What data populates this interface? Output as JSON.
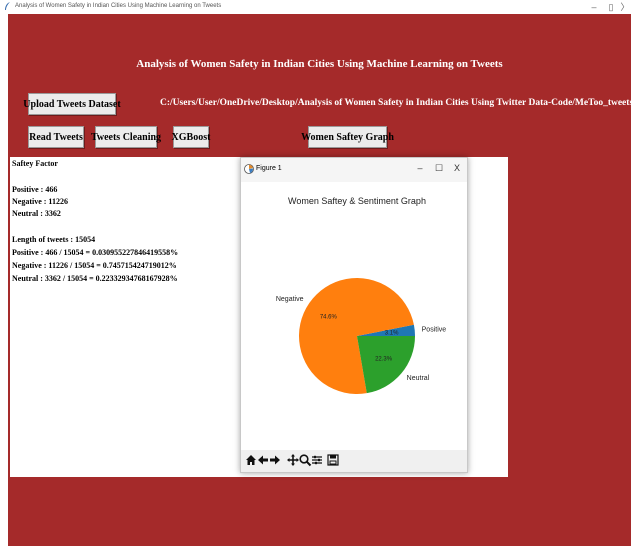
{
  "window": {
    "title": "Analysis of Women Safety in Indian Cities Using Machine Learning on Tweets",
    "minimize": "–",
    "maximize": "▯",
    "close": "〉"
  },
  "app": {
    "heading": "Analysis of Women Safety in Indian Cities Using Machine Learning on Tweets",
    "buttons": {
      "upload": "Upload Tweets Dataset",
      "read": "Read Tweets",
      "clean": "Tweets Cleaning",
      "xgboost": "XGBoost",
      "graph": "Women Saftey Graph"
    },
    "file_path": "C:/Users/User/OneDrive/Desktop/Analysis of Women Safety in Indian Cities Using Twitter Data-Code/MeToo_tweets.csv",
    "output_lines": [
      "Saftey Factor",
      "Positive : 466",
      "Negative : 11226",
      "Neutral  : 3362",
      "Length of tweets  : 15054",
      "Positive : 466 / 15054 = 0.030955227846419558%",
      "Negative : 11226 / 15054 = 0.745715424719012%",
      "Neutral  : 3362 / 15054 = 0.22332934768167928%"
    ]
  },
  "figure": {
    "window_title": "Figure 1",
    "minimize": "–",
    "maximize": "☐",
    "close": "X"
  },
  "chart_data": {
    "type": "pie",
    "title": "Women Saftey & Sentiment Graph",
    "labels": [
      "Positive",
      "Negative",
      "Neutral"
    ],
    "values": [
      3.1,
      74.6,
      22.3
    ],
    "value_labels": [
      "3.1%",
      "74.6%",
      "22.3%"
    ],
    "colors": [
      "#1f77b4",
      "#ff7f0e",
      "#2ca02c"
    ],
    "start_angle_deg": 0,
    "direction": "counterclockwise"
  },
  "colors": {
    "app_background": "#a52a2a",
    "panel": "#ffffff",
    "button": "#ececec"
  }
}
